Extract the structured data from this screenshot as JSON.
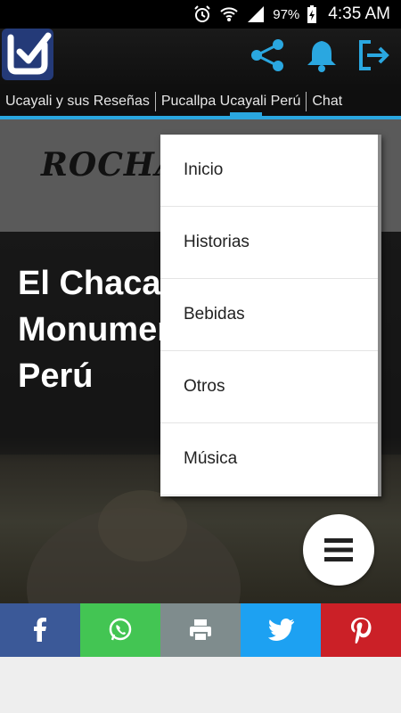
{
  "status_bar": {
    "battery": "97%",
    "time": "4:35 AM"
  },
  "app_bar": {
    "logo_icon": "app-logo-check-icon",
    "actions": [
      "share-icon",
      "bell-icon",
      "exit-icon"
    ],
    "accent_color": "#2aa7e0"
  },
  "tabs": [
    {
      "label": "Ucayali y sus Reseñas"
    },
    {
      "label": "Pucallpa Ucayali Perú",
      "selected": true
    },
    {
      "label": "Chat"
    }
  ],
  "site": {
    "logo_text": "ROCHAN"
  },
  "article": {
    "title": "El Chacarero Monumento Pucallpa Perú"
  },
  "menu": {
    "items": [
      {
        "label": "Inicio"
      },
      {
        "label": "Historias"
      },
      {
        "label": "Bebidas"
      },
      {
        "label": "Otros"
      },
      {
        "label": "Música"
      }
    ]
  },
  "fab": {
    "icon": "menu-icon"
  },
  "share": [
    {
      "icon": "facebook-icon",
      "color": "#3b5998"
    },
    {
      "icon": "whatsapp-icon",
      "color": "#43c553"
    },
    {
      "icon": "print-icon",
      "color": "#7f8c8d"
    },
    {
      "icon": "twitter-icon",
      "color": "#1da1f2"
    },
    {
      "icon": "pinterest-icon",
      "color": "#cb2027"
    }
  ]
}
